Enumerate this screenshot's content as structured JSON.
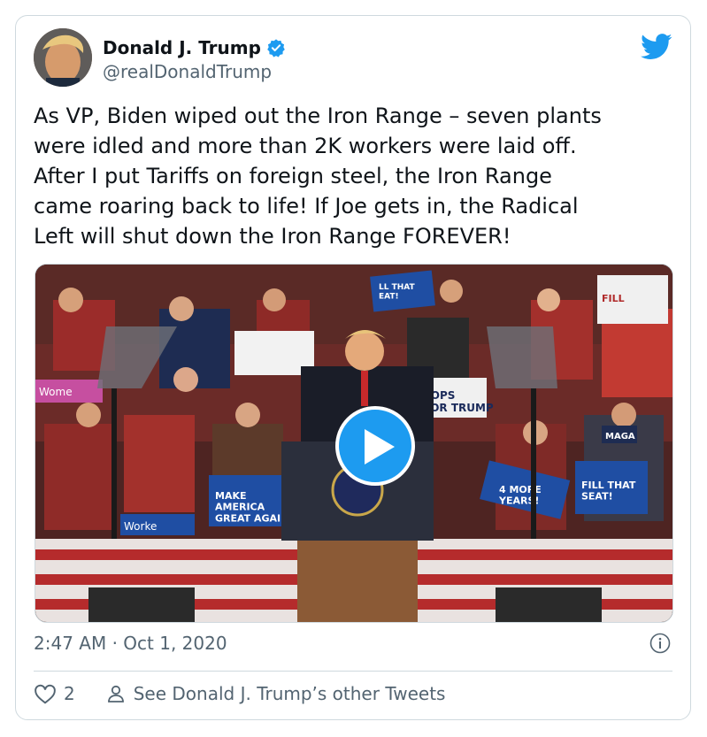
{
  "author": {
    "display_name": "Donald J. Trump",
    "handle": "@realDonaldTrump"
  },
  "tweet": {
    "text": "As VP, Biden wiped out the Iron Range – seven plants\nwere idled and more than 2K workers were laid off.\nAfter I put Tariffs on foreign steel, the Iron Range\ncame roaring back to life! If Joe gets in, the Radical\nLeft will shut down the Iron Range FOREVER!",
    "timestamp": "2:47 AM · Oct 1, 2020"
  },
  "media": {
    "signs": {
      "sign1": "LL THAT\nEAT!",
      "sign2": "COPS\nFOR TRUMP",
      "sign3": "MAKE\nAMERICA\nGREAT AGAI",
      "sign4": "4 MORE\nYEARS!",
      "sign5": "FILL THAT\nSEAT!",
      "sign6": "Wome",
      "sign7": "Worke",
      "sign8": "FILL",
      "sign9": "MAGA"
    }
  },
  "actions": {
    "like_count": "2",
    "other_tweets_label": "See Donald J. Trump’s other Tweets"
  },
  "colors": {
    "accent": "#1d9bf0",
    "text": "#0f1419",
    "secondary": "#536471",
    "border": "#cfd9de"
  },
  "icons": [
    "verified-badge-icon",
    "twitter-bird-icon",
    "play-icon",
    "info-icon",
    "heart-icon",
    "person-icon"
  ]
}
